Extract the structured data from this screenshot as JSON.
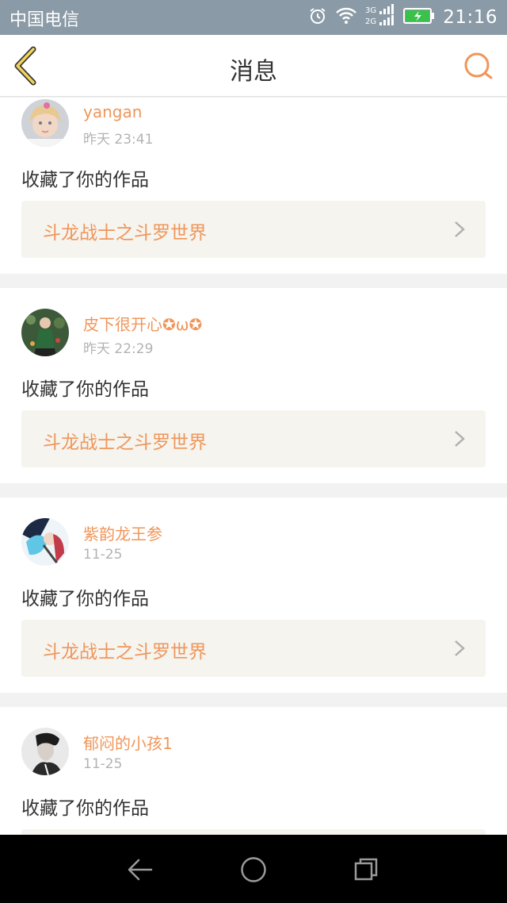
{
  "status_bar": {
    "carrier": "中国电信",
    "network": "3G 2G",
    "time": "21:16",
    "icons": [
      "alarm-icon",
      "wifi-icon",
      "signal-icon",
      "battery-charging-icon"
    ]
  },
  "header": {
    "title": "消息",
    "back_icon": "chevron-left-icon",
    "search_icon": "search-icon",
    "accent_color": "#f0965a"
  },
  "messages": [
    {
      "user": "yangan",
      "time": "昨天 23:41",
      "action": "收藏了你的作品",
      "work": "斗龙战士之斗罗世界"
    },
    {
      "user": "皮下很开心✪ω✪",
      "time": "昨天 22:29",
      "action": "收藏了你的作品",
      "work": "斗龙战士之斗罗世界"
    },
    {
      "user": "紫韵龙王参",
      "time": "11-25",
      "action": "收藏了你的作品",
      "work": "斗龙战士之斗罗世界"
    },
    {
      "user": "郁闷的小孩1",
      "time": "11-25",
      "action": "收藏了你的作品",
      "work": ""
    }
  ],
  "system_nav": {
    "icons": [
      "back-triangle-icon",
      "home-circle-icon",
      "recents-square-icon"
    ]
  }
}
